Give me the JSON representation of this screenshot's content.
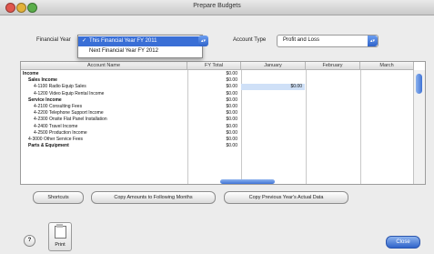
{
  "window": {
    "title": "Prepare Budgets"
  },
  "controls": {
    "financial_year_label": "Financial Year",
    "financial_year_options": [
      "This Financial Year FY 2011",
      "Next Financial Year FY 2012"
    ],
    "financial_year_selected": "This Financial Year FY 2011",
    "account_type_label": "Account Type",
    "account_type_value": "Profit and Loss"
  },
  "table": {
    "headers": [
      "Account Name",
      "FY Total",
      "January",
      "February",
      "March"
    ],
    "rows": [
      {
        "name": "Income",
        "total": "$0.00",
        "jan": "",
        "indent": 0,
        "bold": true
      },
      {
        "name": "Sales Income",
        "total": "$0.00",
        "jan": "",
        "indent": 1,
        "bold": true
      },
      {
        "name": "4-1100 Radio Equip Sales",
        "total": "$0.00",
        "jan": "$0.00",
        "indent": 2,
        "bold": false
      },
      {
        "name": "4-1200 Video Equip Rental Income",
        "total": "$0.00",
        "jan": "",
        "indent": 2,
        "bold": false
      },
      {
        "name": "Service Income",
        "total": "$0.00",
        "jan": "",
        "indent": 1,
        "bold": true
      },
      {
        "name": "4-2100 Consulting Fees",
        "total": "$0.00",
        "jan": "",
        "indent": 2,
        "bold": false
      },
      {
        "name": "4-2200 Telephone Support Income",
        "total": "$0.00",
        "jan": "",
        "indent": 2,
        "bold": false
      },
      {
        "name": "4-2300 Onsite Flat Panel Installation",
        "total": "$0.00",
        "jan": "",
        "indent": 2,
        "bold": false
      },
      {
        "name": "4-2400 Travel Income",
        "total": "$0.00",
        "jan": "",
        "indent": 2,
        "bold": false
      },
      {
        "name": "4-2500 Production Income",
        "total": "$0.00",
        "jan": "",
        "indent": 2,
        "bold": false
      },
      {
        "name": "4-3000 Other Service Fees",
        "total": "$0.00",
        "jan": "",
        "indent": 1,
        "bold": false
      },
      {
        "name": "Parts & Equipment",
        "total": "$0.00",
        "jan": "",
        "indent": 1,
        "bold": true
      }
    ]
  },
  "buttons": {
    "shortcuts": "Shortcuts",
    "copy_following": "Copy Amounts to Following Months",
    "copy_previous": "Copy Previous Year's Actual Data",
    "print": "Print",
    "close": "Close",
    "help": "?"
  },
  "colors": {
    "accent": "#3a6fd6",
    "highlight": "#cfe0f7"
  }
}
